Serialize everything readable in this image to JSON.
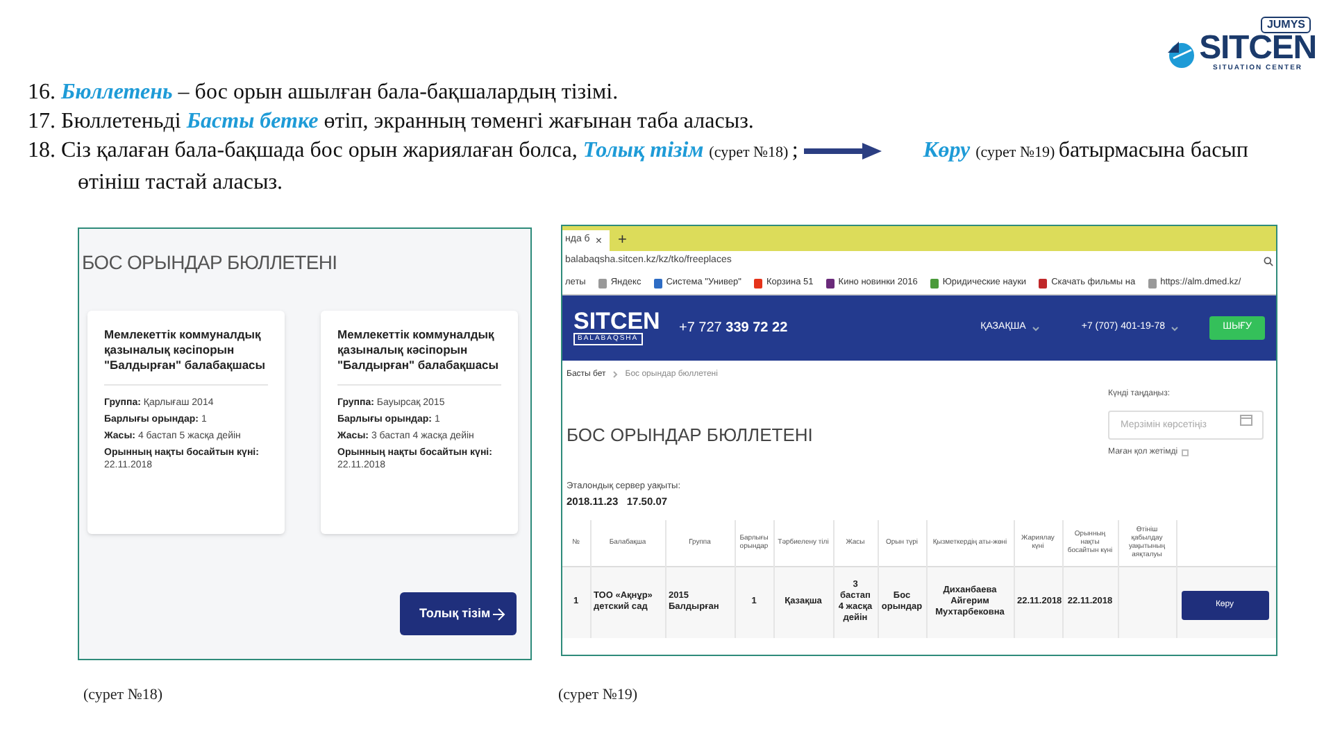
{
  "logo": {
    "badge": "JUMYS",
    "name": "SITCEN",
    "tagline": "SITUATION CENTER"
  },
  "instructions": [
    {
      "number": "16.",
      "parts": [
        {
          "kind": "text",
          "text": "**Бюллетень** – бос орын ашылған бала-бақшалардың тізімі."
        }
      ]
    },
    {
      "number": "17.",
      "parts": [
        {
          "kind": "text",
          "text": "Бюллетеньді **Басты бетке** өтіп, экранның төменгі жағынан таба аласыз."
        }
      ]
    },
    {
      "number": "18.",
      "parts": [
        {
          "kind": "text",
          "text": "Сіз қалаған бала-бақшада бос орын жариялаған болса, **Толық тізім**"
        },
        {
          "kind": "small",
          "text": "(сурет №18)"
        },
        {
          "kind": "text",
          "text": ";"
        },
        {
          "kind": "arrow"
        },
        {
          "kind": "text",
          "text": "**Көру**"
        },
        {
          "kind": "small",
          "text": "(сурет №19)"
        },
        {
          "kind": "text",
          "text": "батырмасына басып өтініш  тастай аласыз."
        }
      ]
    }
  ],
  "screenshot_18": {
    "heading": "БОС ОРЫНДАР БЮЛЛЕТЕНІ",
    "cards": [
      {
        "title": "Мемлекеттік коммуналдық қазыналық кәсіпорын \"Балдырған\" балабақшасы",
        "fields": [
          {
            "label": "Группа:",
            "value": "Қарлығаш 2014"
          },
          {
            "label": "Барлығы орындар:",
            "value": "1"
          },
          {
            "label": "Жасы:",
            "value": "4 бастап 5 жасқа дейін"
          },
          {
            "label": "Орынның нақты босайтын күні:",
            "value": "22.11.2018"
          }
        ]
      },
      {
        "title": "Мемлекеттік коммуналдық қазыналық кәсіпорын \"Балдырған\" балабақшасы",
        "fields": [
          {
            "label": "Группа:",
            "value": "Бауырсақ 2015"
          },
          {
            "label": "Барлығы орындар:",
            "value": "1"
          },
          {
            "label": "Жасы:",
            "value": "3 бастап 4 жасқа дейін"
          },
          {
            "label": "Орынның нақты босайтын күні:",
            "value": "22.11.2018"
          }
        ]
      }
    ],
    "button": "Толық тізім"
  },
  "screenshot_19": {
    "tab": {
      "label": "нда б",
      "close": "×"
    },
    "new_tab": "+",
    "address": "balabaqsha.sitcen.kz/kz/tko/freeplaces",
    "bookmarks": [
      "леты",
      "Яндекс",
      "Система \"Универ\"",
      "Корзина 51",
      "Кино новинки 2016",
      "Юридические науки",
      "Скачать фильмы на",
      "https://alm.dmed.kz/"
    ],
    "header": {
      "logo": "SITCEN",
      "logo_sub": "BALABAQSHA",
      "phone": "+7 727 **339 72 22**",
      "language": "ҚАЗАҚША",
      "user": "+7 (707) 401-19-78",
      "logout": "ШЫҒУ"
    },
    "breadcrumb": [
      "Басты бет",
      "Бос орындар бюллетені"
    ],
    "title": "БОС ОРЫНДАР БЮЛЛЕТЕНІ",
    "date_label": "Күнді таңдаңыз:",
    "date_placeholder": "Мерзімін көрсетіңіз",
    "filter": {
      "label": "Маған қол жетімді",
      "checked": false
    },
    "server_time_label": "Эталондық сервер уақыты:",
    "server_time": "2018.11.23   17.50.07",
    "table": {
      "columns": [
        "№",
        "Балабақша",
        "Группа",
        "Барлығы орындар",
        "Тәрбиелену тілі",
        "Жасы",
        "Орын түрі",
        "Қызметкердің аты-жөні",
        "Жариялау күні",
        "Орынның нақты босайтын күні",
        "Өтініш қабылдау уақытының аяқталуы"
      ],
      "rows": [
        {
          "cells": [
            "1",
            "ТОО «Ақнұр» детский сад",
            "2015 Балдырған",
            "1",
            "Қазақша",
            "3 бастап 4 жасқа дейін",
            "Бос орындар",
            "Диханбаева Айгерим Мухтарбековна",
            "22.11.2018",
            "22.11.2018"
          ],
          "button": "Көру"
        }
      ]
    }
  },
  "captions": [
    "(сурет №18)",
    "(сурет №19)"
  ]
}
